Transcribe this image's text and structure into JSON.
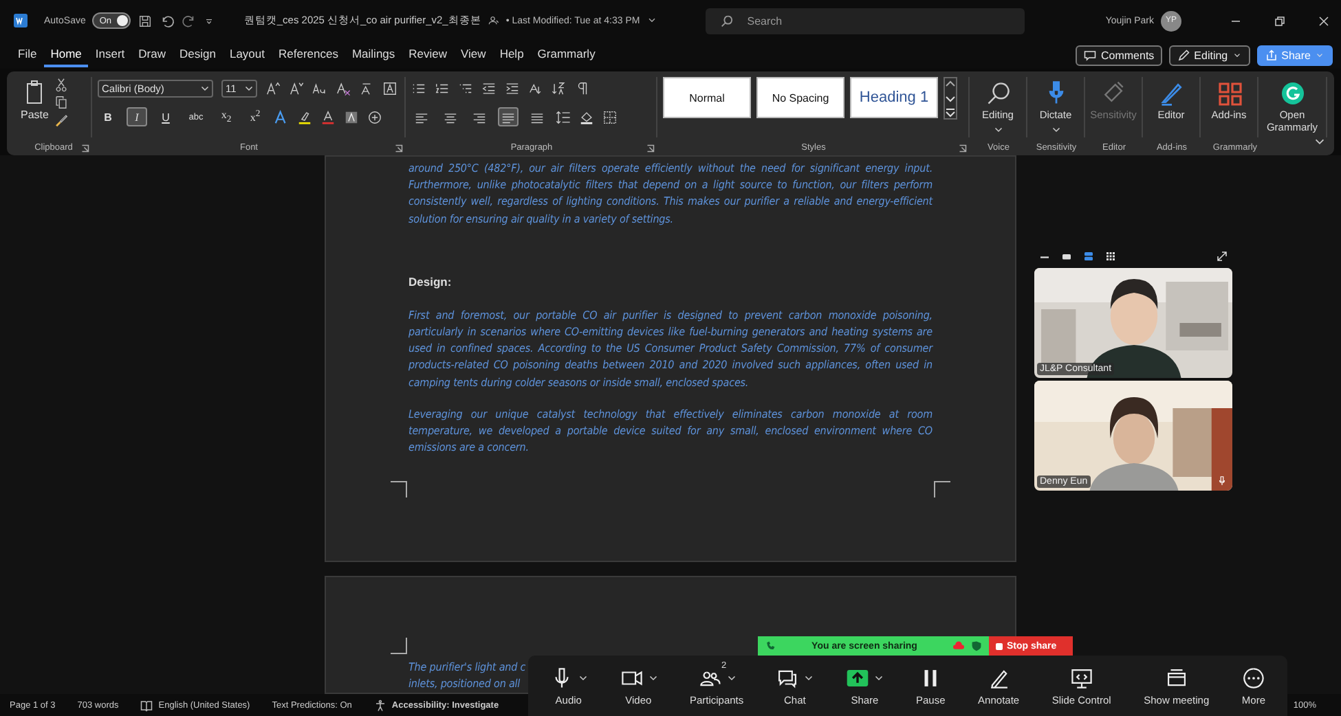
{
  "title_bar": {
    "autosave_label": "AutoSave",
    "autosave_state": "On",
    "autosave_on": true,
    "document_title": "퀀텀캣_ces 2025 신청서_co air purifier_v2_최종본",
    "last_modified": "• Last Modified: Tue at 4:33 PM",
    "search_placeholder": "Search",
    "user_name": "Youjin Park",
    "user_initials": "YP"
  },
  "menu_tabs": [
    {
      "label": "File",
      "selected": false
    },
    {
      "label": "Home",
      "selected": true
    },
    {
      "label": "Insert",
      "selected": false
    },
    {
      "label": "Draw",
      "selected": false
    },
    {
      "label": "Design",
      "selected": false
    },
    {
      "label": "Layout",
      "selected": false
    },
    {
      "label": "References",
      "selected": false
    },
    {
      "label": "Mailings",
      "selected": false
    },
    {
      "label": "Review",
      "selected": false
    },
    {
      "label": "View",
      "selected": false
    },
    {
      "label": "Help",
      "selected": false
    },
    {
      "label": "Grammarly",
      "selected": false
    }
  ],
  "menu_buttons": [
    {
      "label": "Comments",
      "kind": "comments"
    },
    {
      "label": "Editing",
      "kind": "editing"
    },
    {
      "label": "Share",
      "kind": "share"
    }
  ],
  "ribbon": {
    "paste_label": "Paste",
    "font_name": "Calibri (Body)",
    "font_size": "11",
    "format_buttons": [
      {
        "label": "B",
        "kind": "bold",
        "selected": false
      },
      {
        "label": "I",
        "kind": "italic",
        "selected": true
      },
      {
        "label": "U",
        "kind": "underline",
        "selected": false
      },
      {
        "label": "abc",
        "kind": "strike",
        "selected": false
      },
      {
        "label": "x$_{2}$",
        "kind": "plain",
        "selected": false
      },
      {
        "label": "x$^{2}$",
        "kind": "plain",
        "selected": false
      }
    ],
    "alignments": [
      {
        "kind": "left",
        "selected": false
      },
      {
        "kind": "center",
        "selected": false
      },
      {
        "kind": "right",
        "selected": false
      },
      {
        "kind": "justify",
        "selected": true
      },
      {
        "kind": "distribute",
        "selected": false
      }
    ],
    "styles": [
      {
        "label": "Normal",
        "kind": "normal"
      },
      {
        "label": "No Spacing",
        "kind": "normal"
      },
      {
        "label": "Heading 1",
        "kind": "heading"
      }
    ],
    "large_buttons": [
      {
        "label": "Editing",
        "kind": "search",
        "disabled": false,
        "caret": true
      },
      {
        "label": "Dictate",
        "kind": "mic",
        "disabled": false,
        "caret": true
      },
      {
        "label": "Sensitivity",
        "kind": "tag",
        "disabled": true,
        "caret": false
      },
      {
        "label": "Editor",
        "kind": "pen",
        "disabled": false,
        "caret": false
      },
      {
        "label": "Add-ins",
        "kind": "grid",
        "disabled": false,
        "caret": false
      },
      {
        "label": "Open Grammarly",
        "kind": "grammarly",
        "disabled": false,
        "caret": false
      }
    ],
    "group_labels": [
      {
        "label": "Clipboard",
        "launcher": true
      },
      {
        "label": "Font",
        "launcher": true
      },
      {
        "label": "Paragraph",
        "launcher": true
      },
      {
        "label": "Styles",
        "launcher": true
      },
      {
        "label": "Voice",
        "launcher": false
      },
      {
        "label": "Sensitivity",
        "launcher": false
      },
      {
        "label": "Editor",
        "launcher": false
      },
      {
        "label": "Add-ins",
        "launcher": false
      },
      {
        "label": "Grammarly",
        "launcher": false
      }
    ]
  },
  "document": {
    "pages": [
      {
        "blocks": [
          {
            "kind": "paragraph",
            "text": "around 250°C (482°F), our air filters operate efficiently without the need for significant energy input. Furthermore, unlike photocatalytic filters that depend on a light source to function, our filters perform consistently well, regardless of lighting conditions. This makes our purifier a reliable and energy-efficient solution for ensuring air quality in a variety of settings."
          },
          {
            "kind": "heading",
            "text": "Design:"
          },
          {
            "kind": "paragraph",
            "text": "First and foremost, our portable CO air purifier is designed to prevent carbon monoxide poisoning, particularly in scenarios where CO-emitting devices like fuel-burning generators and heating systems are used in confined spaces. According to the US Consumer Product Safety Commission, 77% of consumer products-related CO poisoning deaths between 2010 and 2020 involved such appliances, often used in camping tents during colder seasons or inside small, enclosed spaces."
          },
          {
            "kind": "paragraph",
            "text": "Leveraging our unique catalyst technology that effectively eliminates carbon monoxide at room temperature, we developed a portable device suited for any small, enclosed environment where CO emissions are a concern."
          }
        ]
      },
      {
        "blocks": [
          {
            "kind": "lines",
            "lines": [
              "The purifier's light and c",
              "inlets, positioned on all"
            ]
          }
        ]
      }
    ]
  },
  "video_panel": {
    "tiles": [
      {
        "name": "JL&P Consultant"
      },
      {
        "name": "Denny Eun"
      }
    ]
  },
  "share_bar": {
    "status": "You are screen sharing",
    "stop_label": "Stop share"
  },
  "meeting_toolbar": [
    {
      "label": "Audio",
      "kind": "mic",
      "caret": true
    },
    {
      "label": "Video",
      "kind": "camera",
      "caret": true
    },
    {
      "label": "Participants",
      "kind": "people",
      "caret": true,
      "count": "2"
    },
    {
      "label": "Chat",
      "kind": "chat",
      "caret": true
    },
    {
      "label": "Share",
      "kind": "share",
      "caret": true
    },
    {
      "label": "Pause",
      "kind": "pause",
      "caret": false
    },
    {
      "label": "Annotate",
      "kind": "pen",
      "caret": false
    },
    {
      "label": "Slide Control",
      "kind": "slide",
      "caret": false
    },
    {
      "label": "Show meeting",
      "kind": "meeting",
      "caret": false
    },
    {
      "label": "More",
      "kind": "more",
      "caret": false
    }
  ],
  "status_bar": {
    "items": [
      {
        "label": "Page 1 of 3",
        "kind": "text"
      },
      {
        "label": "703 words",
        "kind": "text"
      },
      {
        "label": "English (United States)",
        "kind": "language"
      },
      {
        "label": "Text Predictions: On",
        "kind": "text"
      },
      {
        "label": "Accessibility: Investigate",
        "kind": "accessibility"
      }
    ],
    "zoom": "100%"
  }
}
